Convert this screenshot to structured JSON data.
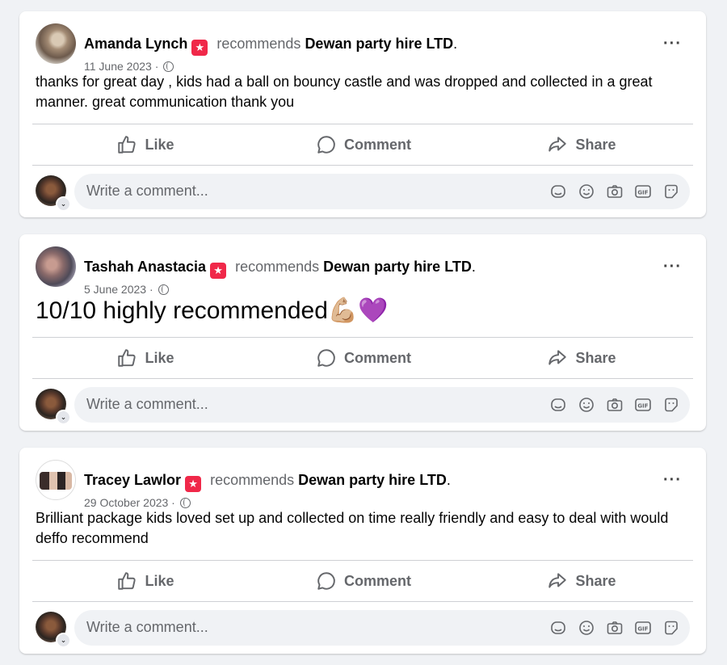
{
  "posts": [
    {
      "author": "Amanda Lynch",
      "action_text": "recommends",
      "page_name": "Dewan party hire LTD",
      "suffix": ".",
      "date": "11 June 2023 ·",
      "body": "thanks for great day , kids had a ball on bouncy castle and was dropped and collected in a great manner. great communication thank you"
    },
    {
      "author": "Tashah Anastacia",
      "action_text": "recommends",
      "page_name": "Dewan party hire LTD",
      "suffix": ".",
      "date": "5 June 2023 ·",
      "body": "10/10 highly recommended",
      "body_emoji": "💪🏼💜"
    },
    {
      "author": "Tracey Lawlor",
      "action_text": "recommends",
      "page_name": "Dewan party hire LTD",
      "suffix": ".",
      "date": "29 October 2023 ·",
      "body": "Brilliant package kids loved set up and collected on time really friendly and easy to deal with would deffo recommend"
    }
  ],
  "actions": {
    "like": "Like",
    "comment": "Comment",
    "share": "Share"
  },
  "comment_box": {
    "placeholder": "Write a comment..."
  },
  "icons": {
    "badge": "recommend-star-icon",
    "privacy": "globe-icon",
    "more": "more-options-icon",
    "like": "thumbs-up-icon",
    "comment": "speech-bubble-icon",
    "share": "share-arrow-icon",
    "tools": [
      "avatar-sticker-icon",
      "emoji-icon",
      "camera-icon",
      "gif-icon",
      "sticker-icon"
    ],
    "gif_label": "GIF"
  },
  "colors": {
    "badge": "#f02849",
    "text_secondary": "#65676b",
    "background": "#f0f2f5"
  }
}
